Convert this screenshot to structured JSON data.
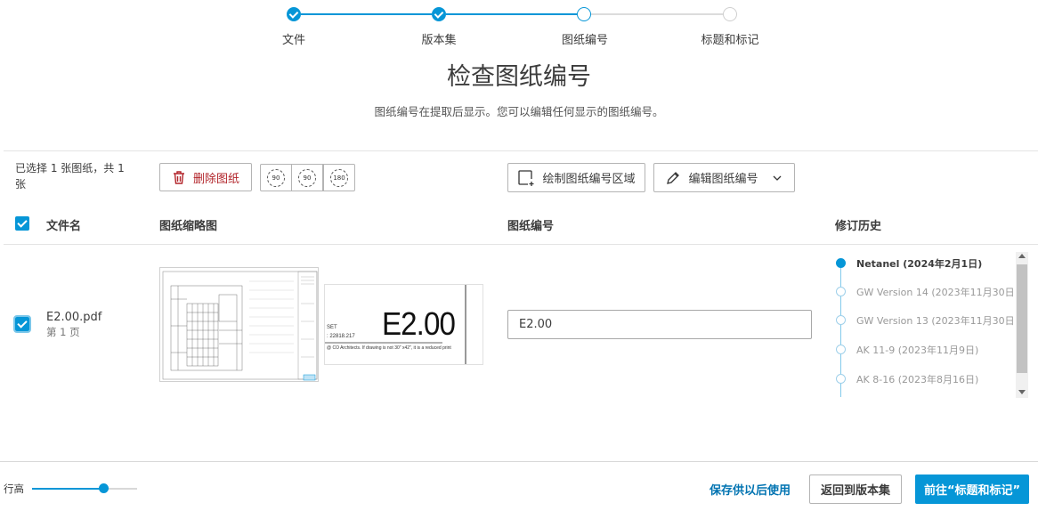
{
  "stepper": {
    "steps": [
      {
        "label": "文件",
        "state": "done"
      },
      {
        "label": "版本集",
        "state": "done"
      },
      {
        "label": "图纸编号",
        "state": "current"
      },
      {
        "label": "标题和标记",
        "state": "pending"
      }
    ]
  },
  "header": {
    "title": "检查图纸编号",
    "subtitle": "图纸编号在提取后显示。您可以编辑任何显示的图纸编号。"
  },
  "toolbar": {
    "selection_info": "已选择 1 张图纸，共 1 张",
    "delete_label": "删除图纸",
    "rotate_left_label": "90",
    "rotate_right_label": "90",
    "rotate_180_label": "180",
    "draw_region_label": "绘制图纸编号区域",
    "edit_numbers_label": "编辑图纸编号"
  },
  "table": {
    "headers": {
      "filename": "文件名",
      "thumbnail": "图纸缩略图",
      "sheet_number": "图纸编号",
      "revision_history": "修订历史"
    },
    "rows": [
      {
        "selected": true,
        "filename": "E2.00.pdf",
        "page": "第 1 页",
        "thumb_set_label": "SET",
        "thumb_date": ": 22818.217",
        "thumb_sheet": "E2.00",
        "thumb_note": "@ CO Architects. If drawing is not 30\" x42\", it is a reduced print",
        "sheet_number": "E2.00",
        "history": [
          {
            "text": "Netanel (2024年2月1日)",
            "active": true
          },
          {
            "text": "GW Version 14 (2023年11月30日)",
            "active": false
          },
          {
            "text": "GW Version 13 (2023年11月30日)",
            "active": false
          },
          {
            "text": "AK 11-9 (2023年11月9日)",
            "active": false
          },
          {
            "text": "AK 8-16 (2023年8月16日)",
            "active": false
          }
        ]
      }
    ]
  },
  "footer": {
    "row_height_label": "行高",
    "row_height_value": 0.68,
    "save_later_label": "保存供以后使用",
    "back_label": "返回到版本集",
    "next_label": "前往“标题和标记”"
  },
  "colors": {
    "accent": "#0696d7",
    "danger": "#b2242a"
  }
}
